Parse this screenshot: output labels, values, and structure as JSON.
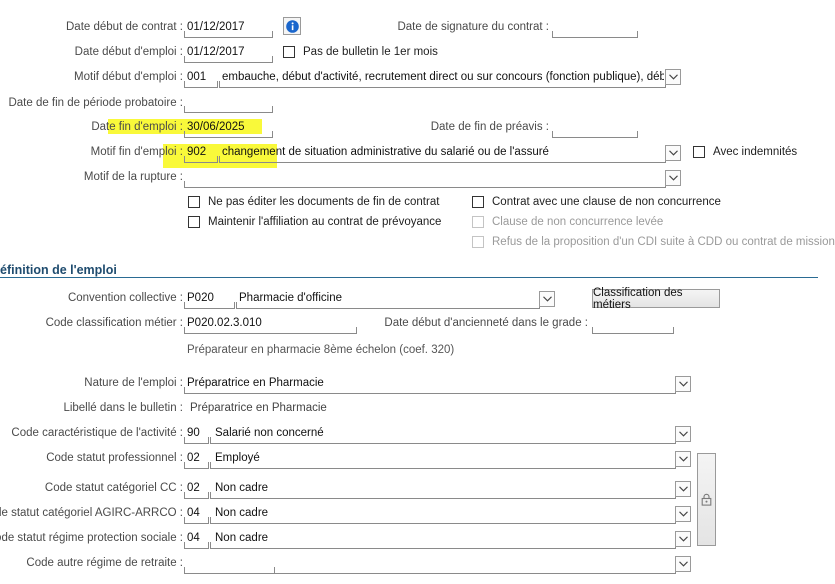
{
  "contract": {
    "date_debut_contrat_label": "Date début de contrat :",
    "date_debut_contrat": "01/12/2017",
    "date_signature_label": "Date de signature du contrat :",
    "date_debut_emploi_label": "Date début d'emploi :",
    "date_debut_emploi": "01/12/2017",
    "pas_bulletin_label": "Pas de bulletin le 1er mois",
    "motif_debut_label": "Motif début d'emploi :",
    "motif_debut_code": "001",
    "motif_debut_text": "embauche, début d'activité, recrutement direct ou sur concours (fonction publique), début de c",
    "date_fin_probatoire_label": "Date de fin de période probatoire :",
    "date_fin_emploi_label": "Date fin d'emploi :",
    "date_fin_emploi": "30/06/2025",
    "date_fin_preavis_label": "Date de fin de préavis :",
    "motif_fin_label": "Motif fin d'emploi :",
    "motif_fin_code": "902",
    "motif_fin_text": "changement de situation administrative du salarié ou de l'assuré",
    "avec_indemnites_label": "Avec indemnités",
    "motif_rupture_label": "Motif de la rupture :",
    "ne_pas_editer_label": "Ne pas éditer les documents de fin de contrat",
    "maintenir_affiliation_label": "Maintenir l'affiliation au contrat de prévoyance",
    "clause_non_concurrence_label": "Contrat avec une clause de non concurrence",
    "clause_levee_label": "Clause de non concurrence levée",
    "refus_cdi_label": "Refus de la proposition d'un CDI suite à CDD ou contrat de mission"
  },
  "emploi": {
    "section_title": "éfinition de l'emploi",
    "convention_label": "Convention collective :",
    "convention_code": "P020",
    "convention_text": "Pharmacie d'officine",
    "classification_button": "Classification des métiers",
    "code_classification_label": "Code classification métier :",
    "code_classification": "P020.02.3.010",
    "date_anciennete_label": "Date début d'ancienneté dans le grade :",
    "classification_desc": "Préparateur en pharmacie 8ème échelon (coef. 320)",
    "nature_label": "Nature de l'emploi :",
    "nature": "Préparatrice en Pharmacie",
    "libelle_label": "Libellé dans le bulletin :",
    "libelle": "Préparatrice en Pharmacie",
    "code_activite_label": "Code caractéristique de l'activité :",
    "code_activite_code": "90",
    "code_activite_text": "Salarié non concerné",
    "statut_pro_label": "Code statut professionnel :",
    "statut_pro_code": "02",
    "statut_pro_text": "Employé",
    "statut_cat_cc_label": "Code statut catégoriel CC :",
    "statut_cat_cc_code": "02",
    "statut_cat_cc_text": "Non cadre",
    "statut_agirc_label": "Code statut catégoriel AGIRC-ARRCO :",
    "statut_agirc_code": "04",
    "statut_agirc_text": "Non cadre",
    "statut_regime_label": "Code statut régime protection sociale :",
    "statut_regime_code": "04",
    "statut_regime_text": "Non cadre",
    "autre_regime_label": "Code autre régime de retraite :"
  },
  "colors": {
    "highlight": "#f9f93a",
    "section": "#1e4b6e",
    "info": "#1a66cc"
  },
  "icons": [
    "info-icon",
    "chevron-down-icon",
    "lock-icon"
  ]
}
